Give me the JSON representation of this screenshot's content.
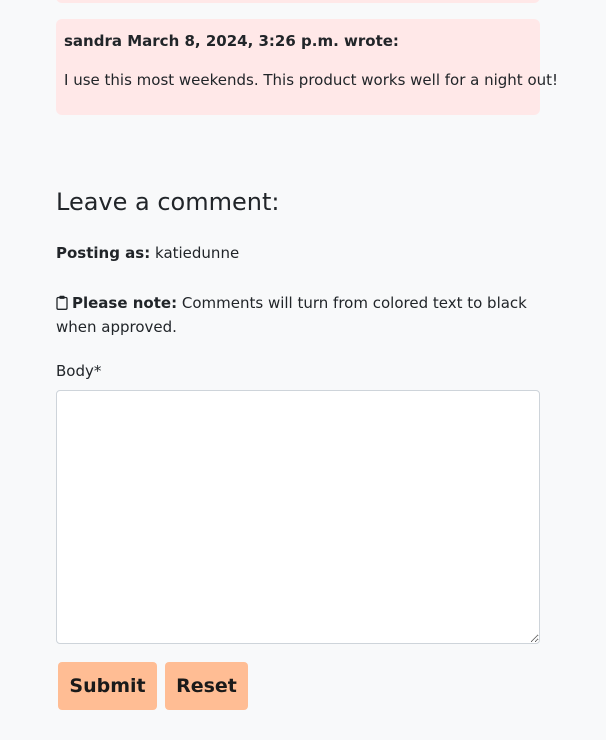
{
  "comment": {
    "author": "sandra",
    "date": "March 8, 2024, 3:26 p.m.",
    "suffix": "wrote:",
    "body": "I use this most weekends. This product works well for a night out!"
  },
  "leave_comment": {
    "title": "Leave a comment:",
    "posting_label": "Posting as:",
    "username": "katiedunne",
    "note_icon": "clipboard-icon",
    "note_label": "Please note:",
    "note_text": "Comments will turn from colored text to black when approved.",
    "body_label": "Body*",
    "body_value": "",
    "submit_label": "Submit",
    "reset_label": "Reset"
  },
  "colors": {
    "comment_bg": "#ffe8e8",
    "button_bg": "#ffbd94",
    "page_bg": "#f8f9fa"
  }
}
